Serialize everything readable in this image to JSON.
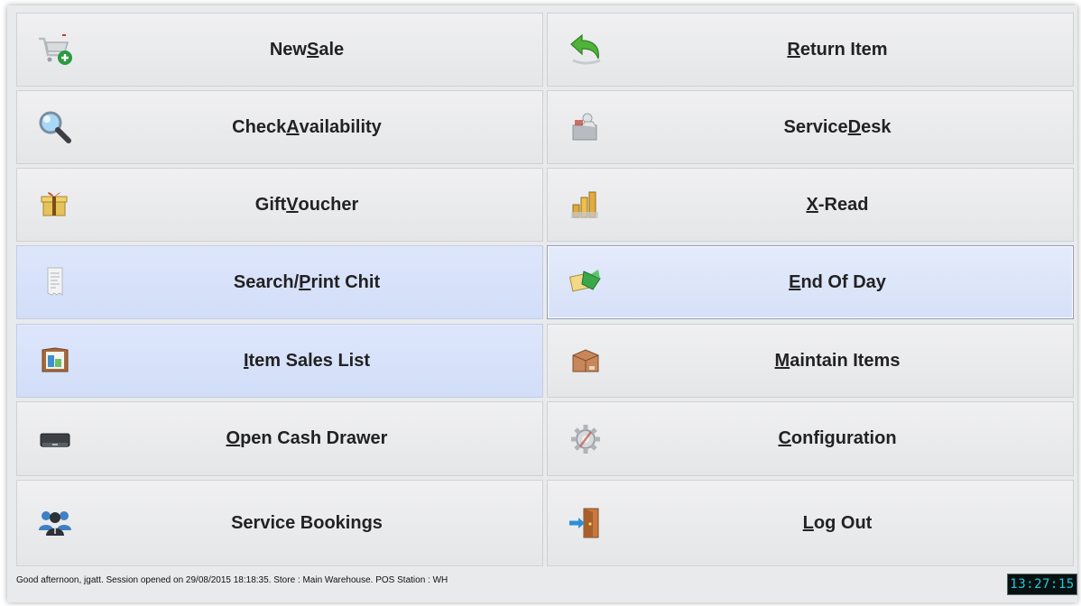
{
  "tiles": [
    {
      "key": "new-sale",
      "pre": "New ",
      "acc": "S",
      "post": "ale",
      "icon": "cart-add-icon"
    },
    {
      "key": "return-item",
      "pre": "",
      "acc": "R",
      "post": "eturn Item",
      "icon": "return-arrow-icon"
    },
    {
      "key": "check-availability",
      "pre": "Check ",
      "acc": "A",
      "post": "vailability",
      "icon": "magnifier-icon"
    },
    {
      "key": "service-desk",
      "pre": "Service ",
      "acc": "D",
      "post": "esk",
      "icon": "service-desk-icon"
    },
    {
      "key": "gift-voucher",
      "pre": "Gift ",
      "acc": "V",
      "post": "oucher",
      "icon": "gift-icon"
    },
    {
      "key": "x-read",
      "pre": "",
      "acc": "X",
      "post": "-Read",
      "icon": "bar-chart-icon"
    },
    {
      "key": "search-print-chit",
      "pre": "Search/",
      "acc": "P",
      "post": "rint Chit",
      "icon": "receipt-icon"
    },
    {
      "key": "end-of-day",
      "pre": "",
      "acc": "E",
      "post": "nd Of Day",
      "icon": "end-of-day-icon"
    },
    {
      "key": "item-sales-list",
      "pre": "",
      "acc": "I",
      "post": "tem Sales List",
      "icon": "sales-list-icon"
    },
    {
      "key": "maintain-items",
      "pre": "",
      "acc": "M",
      "post": "aintain Items",
      "icon": "box-icon"
    },
    {
      "key": "open-cash-drawer",
      "pre": "",
      "acc": "O",
      "post": "pen Cash Drawer",
      "icon": "cash-drawer-icon"
    },
    {
      "key": "configuration",
      "pre": "",
      "acc": "C",
      "post": "onfiguration",
      "icon": "gear-icon"
    },
    {
      "key": "service-bookings",
      "pre": "Service Bookings",
      "acc": "",
      "post": "",
      "icon": "people-icon"
    },
    {
      "key": "log-out",
      "pre": "",
      "acc": "L",
      "post": "og Out",
      "icon": "logout-door-icon"
    }
  ],
  "status": {
    "text": "Good afternoon, jgatt.  Session opened on 29/08/2015 18:18:35.  Store : Main Warehouse.  POS Station : WH"
  },
  "clock": {
    "time": "13:27:15"
  }
}
